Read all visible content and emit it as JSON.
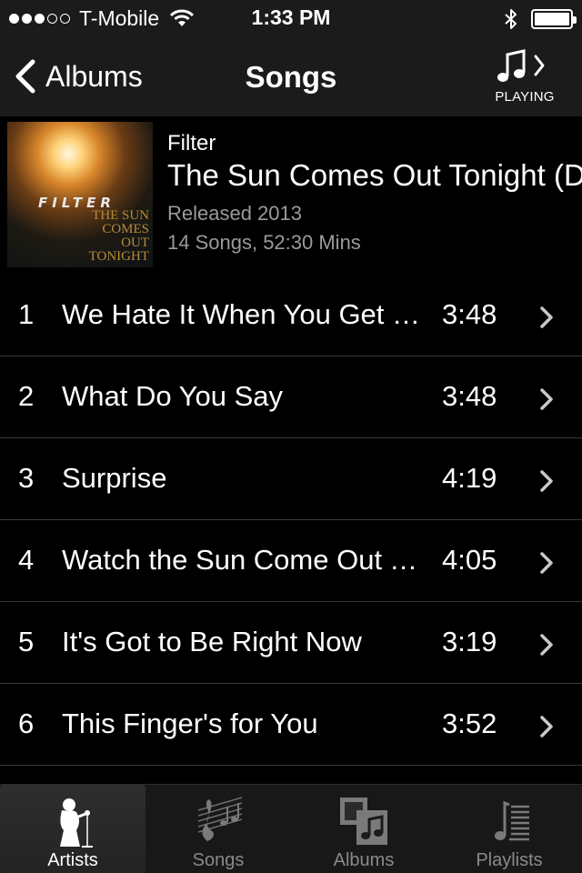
{
  "status_bar": {
    "carrier": "T-Mobile",
    "time": "1:33 PM",
    "signal_strength": 3,
    "signal_max": 5,
    "battery_level": 1.0
  },
  "nav": {
    "back_label": "Albums",
    "title": "Songs",
    "now_playing_label": "PLAYING"
  },
  "album": {
    "artist": "Filter",
    "title": "The Sun Comes Out Tonight (Deluxe",
    "released": "Released 2013",
    "meta": "14 Songs, 52:30 Mins",
    "cover_band": "FILTER",
    "cover_title": "THE SUN COMES OUT TONIGHT"
  },
  "songs": [
    {
      "num": "1",
      "title": "We Hate It When You Get What You Want",
      "time": "3:48"
    },
    {
      "num": "2",
      "title": "What Do You Say",
      "time": "3:48"
    },
    {
      "num": "3",
      "title": "Surprise",
      "time": "4:19"
    },
    {
      "num": "4",
      "title": "Watch the Sun Come Out Tonight",
      "time": "4:05"
    },
    {
      "num": "5",
      "title": "It's Got to Be Right Now",
      "time": "3:19"
    },
    {
      "num": "6",
      "title": "This Finger's for You",
      "time": "3:52"
    }
  ],
  "tabs": [
    {
      "label": "Artists",
      "icon": "artist-icon",
      "active": true
    },
    {
      "label": "Songs",
      "icon": "songs-icon",
      "active": false
    },
    {
      "label": "Albums",
      "icon": "albums-icon",
      "active": false
    },
    {
      "label": "Playlists",
      "icon": "playlists-icon",
      "active": false
    }
  ]
}
